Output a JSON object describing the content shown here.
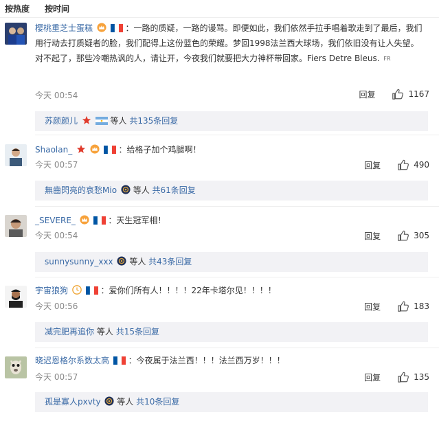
{
  "sort": {
    "hot": "按热度",
    "time": "按时间"
  },
  "comments": [
    {
      "name": "樱桃重芝士蛋糕",
      "text_after": "：一路的质疑，一路的谩骂。即便如此，我们依然手拉手唱着歌走到了最后，我们用行动去打质疑者的脸，我们配得上这份蓝色的荣耀。梦回1998法兰西大球场，我们依旧没有让人失望。 对不起了，那些冷嘲热讽的人，请让开，今夜我们就要把大力神杯带回家。Fiers Detre Bleus.",
      "tag": "FR",
      "time": "今天 00:54",
      "reply_label": "回复",
      "likes": "1167",
      "reply_user": "苏颜颜儿",
      "reply_mid": " 等人",
      "reply_total": "共135条回复"
    },
    {
      "name": "Shaolan_",
      "text_after": "：给格子加个鸡腿啊！",
      "time": "今天 00:57",
      "reply_label": "回复",
      "likes": "490",
      "reply_user": "無齒閃亮的哀愁Mio",
      "reply_mid": " 等人",
      "reply_total": "共61条回复"
    },
    {
      "name": "_SEVERE_",
      "text_after": "：天生冠军相！",
      "time": "今天 00:54",
      "reply_label": "回复",
      "likes": "305",
      "reply_user": "sunnysunny_xxx",
      "reply_mid": " 等人",
      "reply_total": "共43条回复"
    },
    {
      "name": "宇宙狼狗",
      "text_after": "：爱你们所有人！！！！22年卡塔尔见！！！！",
      "time": "今天 00:56",
      "reply_label": "回复",
      "likes": "183",
      "reply_user": "减完肥再追你",
      "reply_mid": " 等人",
      "reply_total": "共15条回复"
    },
    {
      "name": "晓迟恩格尔系数太高",
      "text_after": "：今夜属于法兰西！！！法兰西万岁！！！",
      "time": "今天 00:57",
      "reply_label": "回复",
      "likes": "135",
      "reply_user": "孤是寡人pxvty",
      "reply_mid": " 等人",
      "reply_total": "共10条回复"
    }
  ],
  "colors": {
    "link": "#3a6aa6",
    "reply_bg": "#f2f2f5",
    "france_blue": "#0055a4",
    "france_red": "#ef4135",
    "argentina_blue": "#74acdf"
  }
}
